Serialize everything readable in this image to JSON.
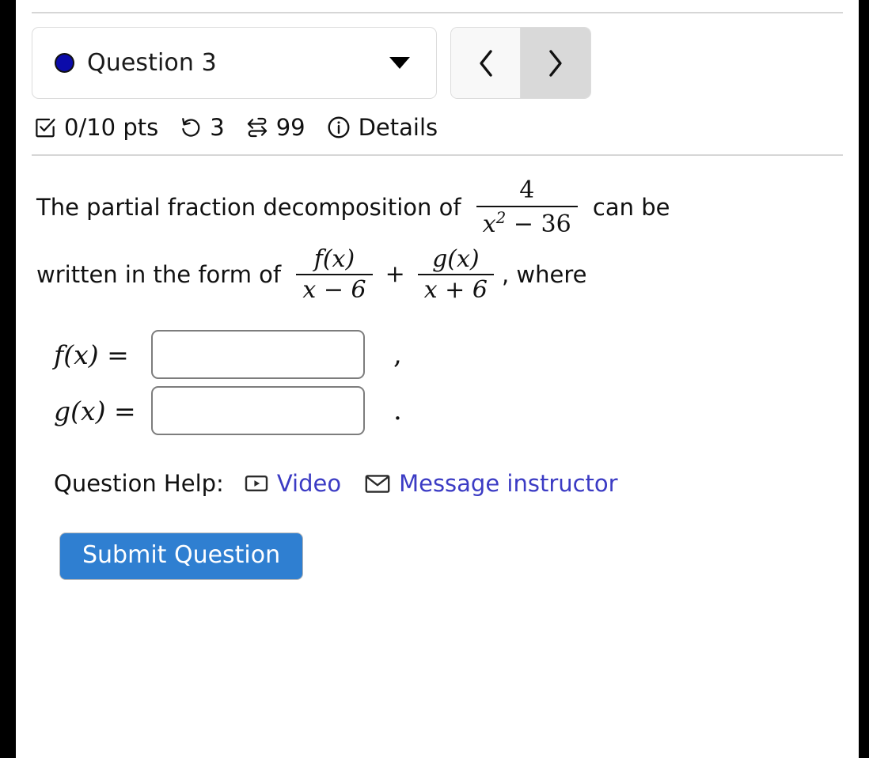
{
  "window": {
    "gutter_color": "#000000",
    "page_background": "#ffffff"
  },
  "header": {
    "question_selector": {
      "dot_color": "#0b0baa",
      "label": "Question 3",
      "caret_icon": "chevron-down-icon"
    },
    "nav": {
      "prev_label": "‹",
      "next_label": "›",
      "prev_state": "normal",
      "next_state": "active"
    }
  },
  "status": {
    "points": "0/10 pts",
    "attempts": "3",
    "versions": "99",
    "details": "Details"
  },
  "question": {
    "line1_before": "The partial fraction decomposition of ",
    "fraction1": {
      "numerator": "4",
      "denominator_base": "x",
      "denominator_sup": "2",
      "denominator_rest": " − 36"
    },
    "line1_after": " can be",
    "line2_before": "written in the form of ",
    "fraction2": {
      "numerator": "f(x)",
      "denominator": "x − 6"
    },
    "plus": "+",
    "fraction3": {
      "numerator": "g(x)",
      "denominator": "x + 6"
    },
    "line2_after": ", where"
  },
  "answers": [
    {
      "label": "f(x)",
      "equals": " = ",
      "value": "",
      "placeholder": "",
      "punctuation": ","
    },
    {
      "label": "g(x)",
      "equals": " = ",
      "value": "",
      "placeholder": "",
      "punctuation": "."
    }
  ],
  "help": {
    "label": "Question Help:",
    "links": [
      {
        "icon": "video-icon",
        "text": "Video"
      },
      {
        "icon": "envelope-icon",
        "text": "Message instructor"
      }
    ],
    "link_color": "#3b3bc4"
  },
  "submit": {
    "label": "Submit Question",
    "color": "#2f7fd1"
  }
}
